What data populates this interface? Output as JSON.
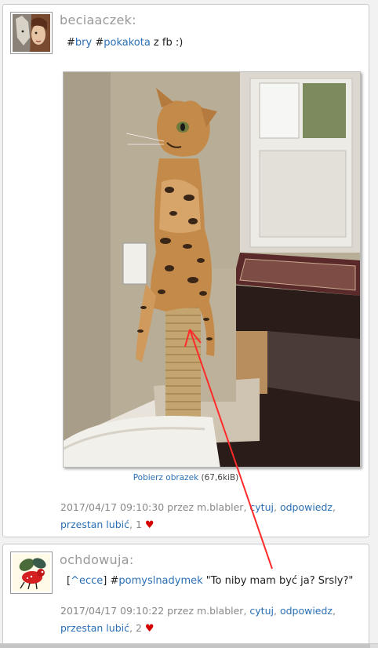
{
  "posts": [
    {
      "username": "beciaaczek:",
      "text": {
        "tag1": "bry",
        "tag2": "pokakota",
        "rest": " z fb :)"
      },
      "download": {
        "link": "Pobierz obrazek",
        "size": " (67,6kiB)"
      },
      "meta": {
        "timestamp": "2017/04/17 09:10:30 przez m.blabler",
        "cite": "cytuj",
        "reply": "odpowiedz",
        "unlike": "przestan lubić",
        "likes": "1"
      }
    },
    {
      "username": "ochdowuja:",
      "text": {
        "reference": "^ecce",
        "tag": "pomyslnadymek",
        "rest": " \"To niby mam być ja? Srsly?\""
      },
      "meta": {
        "timestamp": "2017/04/17 09:10:22 przez m.blabler",
        "cite": "cytuj",
        "reply": "odpowiedz",
        "unlike": "przestan lubić",
        "likes": "2"
      }
    }
  ],
  "colors": {
    "link": "#2a6fb5",
    "heart": "#d40000",
    "arrow": "#ff2a2a",
    "username": "#999999"
  },
  "icons": {
    "heart": "heart-icon"
  }
}
